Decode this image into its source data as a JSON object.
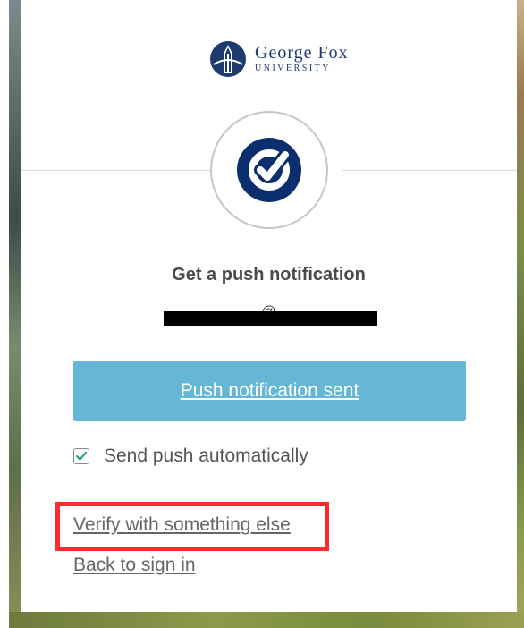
{
  "logo": {
    "name": "George Fox",
    "subtitle": "UNIVERSITY"
  },
  "factor": {
    "icon": "okta-verify-check-icon"
  },
  "heading": "Get a push notification",
  "identifier": "@",
  "push_button_label": "Push notification sent",
  "auto_push": {
    "label": "Send push automatically",
    "checked": true
  },
  "links": {
    "verify_other": "Verify with something else",
    "back": "Back to sign in"
  },
  "colors": {
    "brand_navy": "#0b2f6e",
    "button_blue": "#66b6d6",
    "check_green": "#2aa37a",
    "highlight_red": "#ff2b2b"
  }
}
